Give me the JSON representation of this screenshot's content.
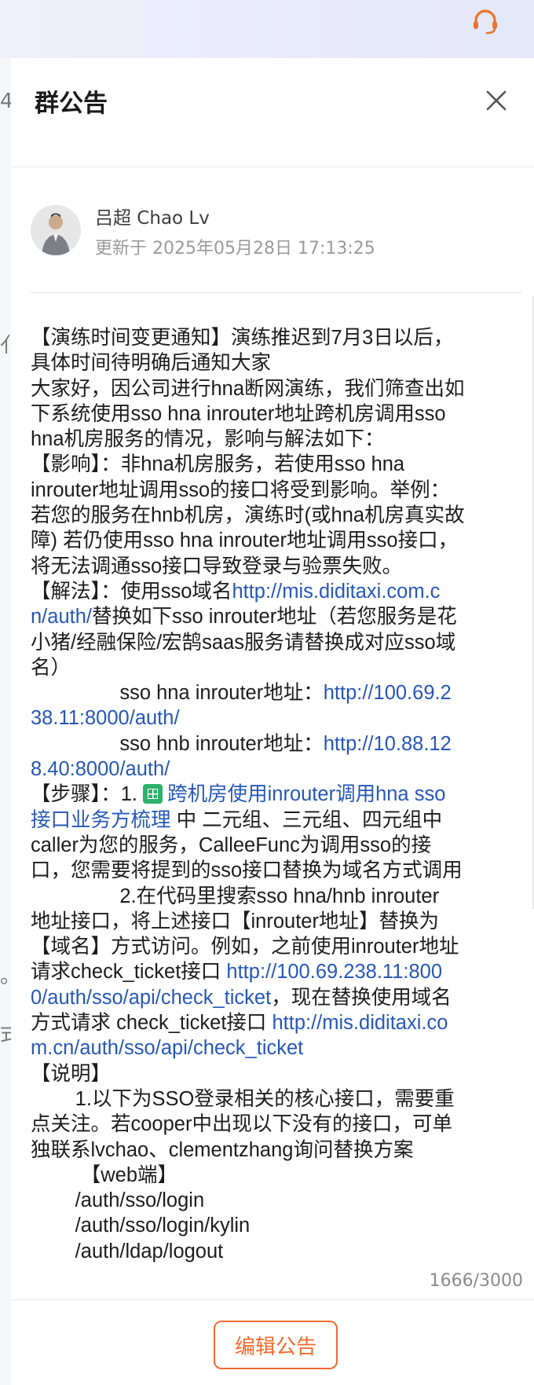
{
  "header": {
    "icon": "headset-icon"
  },
  "panel": {
    "title": "群公告",
    "close_icon": "close-icon"
  },
  "author": {
    "name": "吕超 Chao Lv",
    "updated": "更新于 2025年05月28日 17:13:25"
  },
  "content_lines": [
    [
      {
        "t": "【演练时间变更通知】演练推迟到7月3日以后，"
      }
    ],
    [
      {
        "t": "具体时间待明确后通知大家"
      }
    ],
    [
      {
        "t": "大家好，因公司进行hna断网演练，我们筛查出如"
      }
    ],
    [
      {
        "t": "下系统使用sso hna inrouter地址跨机房调用sso"
      }
    ],
    [
      {
        "t": "hna机房服务的情况，影响与解法如下："
      }
    ],
    [
      {
        "t": "【影响】：非hna机房服务，若使用sso hna"
      }
    ],
    [
      {
        "t": "inrouter地址调用sso的接口将受到影响。举例："
      }
    ],
    [
      {
        "t": "若您的服务在hnb机房，演练时(或hna机房真实故"
      }
    ],
    [
      {
        "t": "障) 若仍使用sso hna inrouter地址调用sso接口，"
      }
    ],
    [
      {
        "t": "将无法调通sso接口导致登录与验票失败。"
      }
    ],
    [
      {
        "t": "【解法】：使用sso域名"
      },
      {
        "t": "http://mis.diditaxi.com.c",
        "link": true
      }
    ],
    [
      {
        "t": "n/auth/",
        "link": true
      },
      {
        "t": "替换如下sso inrouter地址（若您服务是花"
      }
    ],
    [
      {
        "t": "小猪/经融保险/宏鹄saas服务请替换成对应sso域"
      }
    ],
    [
      {
        "t": "名）"
      }
    ],
    [
      {
        "t": "                sso hna inrouter地址："
      },
      {
        "t": "http://100.69.2",
        "link": true
      }
    ],
    [
      {
        "t": "38.11:8000/auth/",
        "link": true
      }
    ],
    [
      {
        "t": "                sso hnb inrouter地址："
      },
      {
        "t": "http://10.88.12",
        "link": true
      }
    ],
    [
      {
        "t": "8.40:8000/auth/",
        "link": true
      }
    ],
    [
      {
        "t": "【步骤】：1. "
      },
      {
        "icon": "sheet-icon"
      },
      {
        "t": "跨机房使用inrouter调用hna sso",
        "link": true
      }
    ],
    [
      {
        "t": "接口业务方梳理",
        "link": true
      },
      {
        "t": " 中 二元组、三元组、四元组中"
      }
    ],
    [
      {
        "t": "caller为您的服务，CalleeFunc为调用sso的接"
      }
    ],
    [
      {
        "t": "口，您需要将提到的sso接口替换为域名方式调用"
      }
    ],
    [
      {
        "t": "                2.在代码里搜索sso hna/hnb inrouter"
      }
    ],
    [
      {
        "t": "地址接口，将上述接口【inrouter地址】替换为"
      }
    ],
    [
      {
        "t": "【域名】方式访问。例如，之前使用inrouter地址"
      }
    ],
    [
      {
        "t": "请求check_ticket接口 "
      },
      {
        "t": "http://100.69.238.11:800",
        "link": true
      }
    ],
    [
      {
        "t": "0/auth/sso/api/check_ticket",
        "link": true
      },
      {
        "t": "，现在替换使用域名"
      }
    ],
    [
      {
        "t": "方式请求 check_ticket接口 "
      },
      {
        "t": "http://mis.diditaxi.co",
        "link": true
      }
    ],
    [
      {
        "t": "m.cn/auth/sso/api/check_ticket",
        "link": true
      }
    ],
    [
      {
        "t": "【说明】"
      }
    ],
    [
      {
        "t": "        1.以下为SSO登录相关的核心接口，需要重"
      }
    ],
    [
      {
        "t": "点关注。若cooper中出现以下没有的接口，可单"
      }
    ],
    [
      {
        "t": "独联系lvchao、clementzhang询问替换方案"
      }
    ],
    [
      {
        "t": "         【web端】"
      }
    ],
    [
      {
        "t": "        /auth/sso/login"
      }
    ],
    [
      {
        "t": "        /auth/sso/login/kylin"
      }
    ],
    [
      {
        "t": "        /auth/ldap/logout"
      }
    ]
  ],
  "footer": {
    "counter": "1666/3000",
    "edit_label": "编辑公告"
  }
}
